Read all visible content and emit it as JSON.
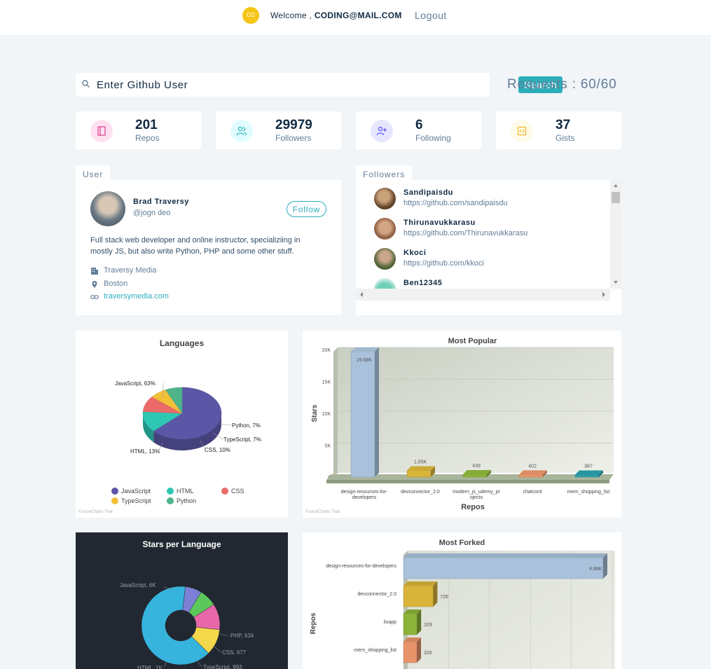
{
  "nav": {
    "avatar_initials": "CO",
    "welcome_prefix": "Welcome ,",
    "user_email": "CODING@MAIL.COM",
    "logout_label": "Logout"
  },
  "search": {
    "placeholder": "Enter Github User",
    "button_label": "Search",
    "requests_text": "Requests : 60/60"
  },
  "stats": [
    {
      "value": "201",
      "label": "Repos",
      "icon": "book-icon",
      "color": "#da4a91",
      "bg": "#ffe0f0"
    },
    {
      "value": "29979",
      "label": "Followers",
      "icon": "users-icon",
      "color": "#2caeba",
      "bg": "#e0fcff"
    },
    {
      "value": "6",
      "label": "Following",
      "icon": "user-plus-icon",
      "color": "#5d55fa",
      "bg": "#e6e6ff"
    },
    {
      "value": "37",
      "label": "Gists",
      "icon": "code-icon",
      "color": "#f0b429",
      "bg": "#fffbea"
    }
  ],
  "user": {
    "tab_label": "User",
    "name": "Brad Traversy",
    "handle": "@jogn deo",
    "follow_label": "Follow",
    "bio": "Full stack web developer and online instructor, specializiing in mostly JS, but also write Python, PHP and some other stuff.",
    "company": "Traversy Media",
    "location": "Boston",
    "blog": "traversymedia.com"
  },
  "followers": {
    "tab_label": "Followers",
    "items": [
      {
        "login": "Sandipaisdu",
        "url": "https://github.com/sandipaisdu"
      },
      {
        "login": "Thirunavukkarasu",
        "url": "https://github.com/Thirunavukkarasu"
      },
      {
        "login": "Kkoci",
        "url": "https://github.com/kkoci"
      },
      {
        "login": "Ben12345",
        "url": ""
      }
    ]
  },
  "trial_text": "FusionCharts Trial",
  "chart_data": [
    {
      "type": "pie",
      "title": "Languages",
      "slices": [
        {
          "label": "JavaScript",
          "value": 63,
          "text": "JavaScript, 63%",
          "color": "#5b57a6"
        },
        {
          "label": "HTML",
          "value": 13,
          "text": "HTML, 13%",
          "color": "#2ec7b4"
        },
        {
          "label": "CSS",
          "value": 10,
          "text": "CSS, 10%",
          "color": "#ea6a6a"
        },
        {
          "label": "TypeScript",
          "value": 7,
          "text": "TypeScript, 7%",
          "color": "#f2c037"
        },
        {
          "label": "Python",
          "value": 7,
          "text": "Python, 7%",
          "color": "#4fb38b"
        }
      ],
      "legend_placement": "bottom"
    },
    {
      "type": "bar",
      "title": "Most Popular",
      "xlabel": "Repos",
      "ylabel": "Stars",
      "ylim": [
        0,
        20000
      ],
      "yticks": [
        "0",
        "5K",
        "10K",
        "15K",
        "20K"
      ],
      "categories": [
        "design-resources-for-developers",
        "devconnector_2.0",
        "modern_js_udemy_projects",
        "chatcord",
        "mern_shopping_list"
      ],
      "category_labels": [
        [
          "design-resources-for-",
          "developers"
        ],
        [
          "devconnector_2.0"
        ],
        [
          "modern_js_udemy_pr",
          "ojects"
        ],
        [
          "chatcord"
        ],
        [
          "mern_shopping_list"
        ]
      ],
      "values": [
        19680,
        1050,
        439,
        402,
        387
      ],
      "value_labels": [
        "19.68K",
        "1.05K",
        "439",
        "402",
        "387"
      ],
      "colors": [
        "#a9c1da",
        "#d8b43a",
        "#8cb43a",
        "#e8946a",
        "#2a9ea8"
      ]
    },
    {
      "type": "pie",
      "title": "Stars per Language",
      "slices": [
        {
          "label": "JavaScript",
          "value": 6000,
          "text": "JavaScript, 6K",
          "color": "#36b4de"
        },
        {
          "label": "PHP",
          "value": 634,
          "text": "PHP, 634",
          "color": "#7d81d6"
        },
        {
          "label": "CSS",
          "value": 677,
          "text": "CSS, 677",
          "color": "#5cc85c"
        },
        {
          "label": "TypeScript",
          "value": 993,
          "text": "TypeScript, 993",
          "color": "#e867a9"
        },
        {
          "label": "HTML",
          "value": 1000,
          "text": "HTML, 1K",
          "color": "#f4d74a"
        }
      ]
    },
    {
      "type": "bar",
      "title": "Most Forked",
      "ylabel": "Repos",
      "categories": [
        "design-resources-for-developers",
        "devconnector_2.0",
        "lisapp",
        "mern_shopping_list"
      ],
      "values": [
        4880,
        726,
        329,
        326
      ],
      "value_labels": [
        "4.88K",
        "726",
        "329",
        "326"
      ],
      "colors": [
        "#a9c1da",
        "#d8b43a",
        "#8cb43a",
        "#e8946a"
      ]
    }
  ]
}
